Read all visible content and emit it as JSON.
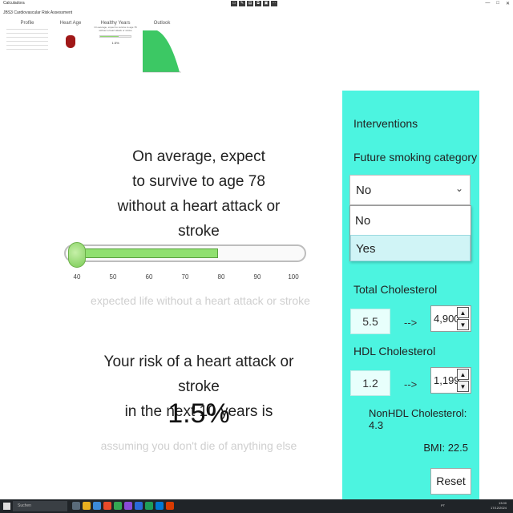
{
  "window": {
    "app_title": "Calculadora",
    "doc_title": "JBS3 Cardiovascular Risk Assessment",
    "controls": [
      "—",
      "□",
      "✕"
    ]
  },
  "thumbnails": [
    {
      "label": "Profile"
    },
    {
      "label": "Heart Age"
    },
    {
      "label": "Healthy Years",
      "text": "On average, expect to survive to age 78 without a heart attack or stroke",
      "pct": "1.5%"
    },
    {
      "label": "Outlook"
    }
  ],
  "main": {
    "survive_lines": [
      "On average, expect",
      "to survive to age 78",
      "without a heart attack or stroke"
    ],
    "slider": {
      "min": 40,
      "max": 100,
      "knob_value": 40,
      "fill_to": 79,
      "ticks": [
        "40",
        "50",
        "60",
        "70",
        "80",
        "90",
        "100"
      ]
    },
    "slider_caption": "expected life without a heart attack or stroke",
    "risk_lines": [
      "Your risk of a heart attack or stroke",
      "in the next 10 years is"
    ],
    "risk_value": "1.5%",
    "risk_caption": "assuming you don't die of anything else"
  },
  "interventions": {
    "title": "Interventions",
    "smoking_label": "Future smoking category",
    "smoking_selected": "No",
    "smoking_options": [
      "No",
      "Yes"
    ],
    "smoking_highlighted": "Yes",
    "total_chol_label": "Total Cholesterol",
    "total_chol_current": "5.5",
    "total_chol_target": "4,900",
    "hdl_label": "HDL Cholesterol",
    "hdl_current": "1.2",
    "hdl_target": "1,199",
    "arrow": "-->",
    "nonhdl": "NonHDL Cholesterol: 4.3",
    "bmi": "BMI: 22.5",
    "reset_label": "Reset"
  },
  "taskbar": {
    "search_placeholder": "Suchen",
    "lang": "PT",
    "time": "13:00",
    "date": "17/12/2024"
  },
  "colors": {
    "panel": "#4cf4e0",
    "slider_fill": "#90e070",
    "taskbar": "#202428"
  }
}
